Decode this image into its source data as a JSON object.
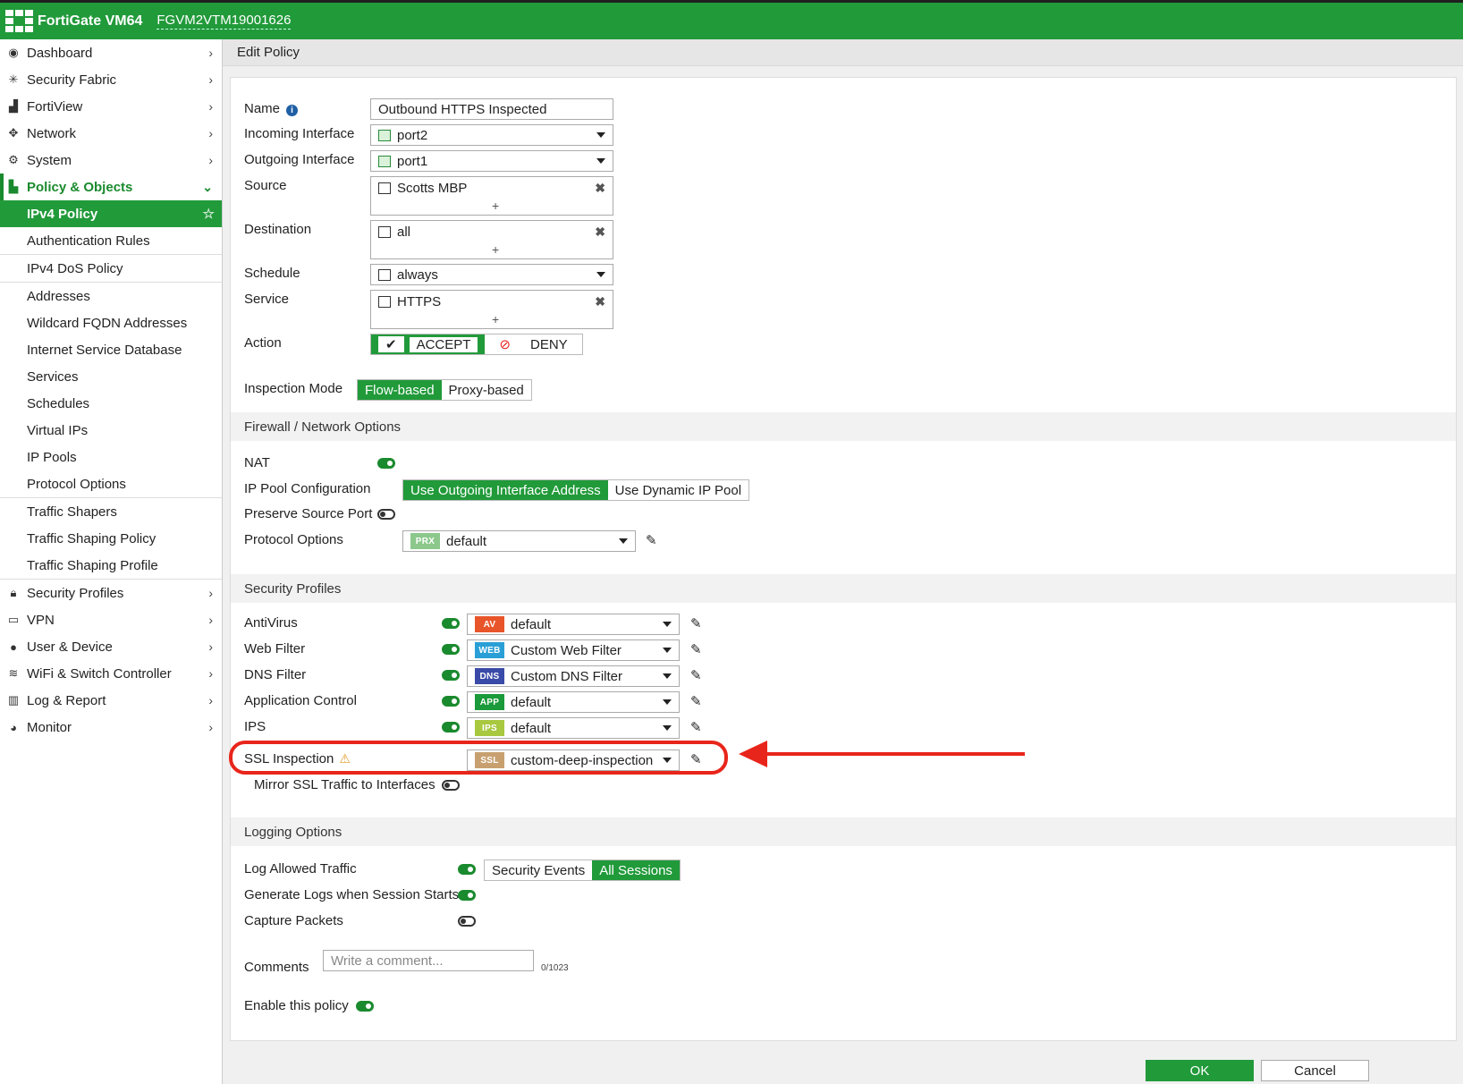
{
  "header": {
    "product": "FortiGate VM64",
    "serial": "FGVM2VTM19001626"
  },
  "sidebar": {
    "top_items": [
      {
        "label": "Dashboard",
        "icon": "dashboard-icon"
      },
      {
        "label": "Security Fabric",
        "icon": "fabric-icon"
      },
      {
        "label": "FortiView",
        "icon": "chart-icon"
      },
      {
        "label": "Network",
        "icon": "network-icon"
      },
      {
        "label": "System",
        "icon": "gear-icon"
      }
    ],
    "policy_objects": "Policy & Objects",
    "sub_items": [
      "IPv4 Policy",
      "Authentication Rules",
      "IPv4 DoS Policy",
      "Addresses",
      "Wildcard FQDN Addresses",
      "Internet Service Database",
      "Services",
      "Schedules",
      "Virtual IPs",
      "IP Pools",
      "Protocol Options",
      "Traffic Shapers",
      "Traffic Shaping Policy",
      "Traffic Shaping Profile"
    ],
    "bottom_items": [
      {
        "label": "Security Profiles",
        "icon": "lock-icon"
      },
      {
        "label": "VPN",
        "icon": "laptop-icon"
      },
      {
        "label": "User & Device",
        "icon": "user-icon"
      },
      {
        "label": "WiFi & Switch Controller",
        "icon": "wifi-icon"
      },
      {
        "label": "Log & Report",
        "icon": "bar-chart-icon"
      },
      {
        "label": "Monitor",
        "icon": "pie-icon"
      }
    ]
  },
  "page": {
    "title": "Edit Policy"
  },
  "form": {
    "name_label": "Name",
    "name_value": "Outbound HTTPS Inspected",
    "incoming_label": "Incoming Interface",
    "incoming_value": "port2",
    "outgoing_label": "Outgoing Interface",
    "outgoing_value": "port1",
    "source_label": "Source",
    "source_value": "Scotts MBP",
    "destination_label": "Destination",
    "destination_value": "all",
    "schedule_label": "Schedule",
    "schedule_value": "always",
    "service_label": "Service",
    "service_value": "HTTPS",
    "action_label": "Action",
    "accept": "ACCEPT",
    "deny": "DENY",
    "inspection_label": "Inspection Mode",
    "flow": "Flow-based",
    "proxy": "Proxy-based"
  },
  "firewall": {
    "title": "Firewall / Network Options",
    "nat": "NAT",
    "ip_pool_label": "IP Pool Configuration",
    "ip_pool_outgoing": "Use Outgoing Interface Address",
    "ip_pool_dynamic": "Use Dynamic IP Pool",
    "preserve_port": "Preserve Source Port",
    "protocol_label": "Protocol Options",
    "protocol_badge": "PRX",
    "protocol_value": "default"
  },
  "security": {
    "title": "Security Profiles",
    "rows": [
      {
        "label": "AntiVirus",
        "badge": "AV",
        "color": "#e8552a",
        "value": "default"
      },
      {
        "label": "Web Filter",
        "badge": "WEB",
        "color": "#2a9fd6",
        "value": "Custom Web Filter"
      },
      {
        "label": "DNS Filter",
        "badge": "DNS",
        "color": "#3a4aa8",
        "value": "Custom DNS Filter"
      },
      {
        "label": "Application Control",
        "badge": "APP",
        "color": "#1a9a3a",
        "value": "default"
      },
      {
        "label": "IPS",
        "badge": "IPS",
        "color": "#a8c840",
        "value": "default"
      }
    ],
    "ssl_label": "SSL Inspection",
    "ssl_badge": "SSL",
    "ssl_color": "#c8a070",
    "ssl_value": "custom-deep-inspection",
    "mirror": "Mirror SSL Traffic to Interfaces"
  },
  "logging": {
    "title": "Logging Options",
    "log_allowed": "Log Allowed Traffic",
    "security_events": "Security Events",
    "all_sessions": "All Sessions",
    "session_start": "Generate Logs when Session Starts",
    "capture": "Capture Packets"
  },
  "comments": {
    "label": "Comments",
    "placeholder": "Write a comment...",
    "counter": "0/1023"
  },
  "enable": "Enable this policy",
  "buttons": {
    "ok": "OK",
    "cancel": "Cancel"
  }
}
